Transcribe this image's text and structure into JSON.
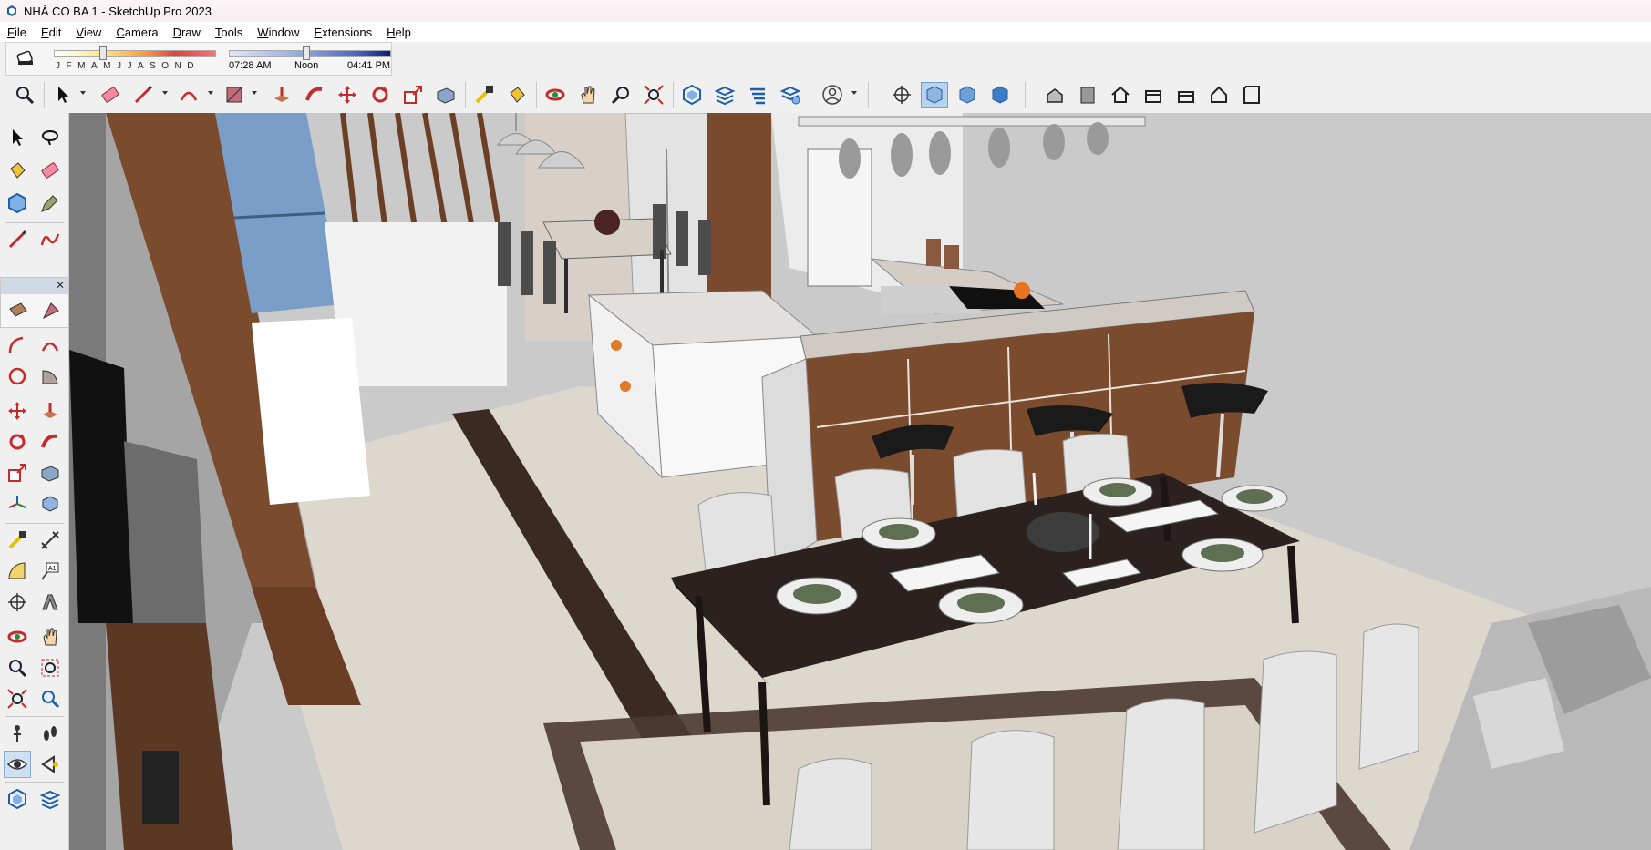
{
  "window": {
    "title": "NHÀ CO BA 1 - SketchUp Pro 2023"
  },
  "menu": [
    {
      "key": "F",
      "rest": "ile"
    },
    {
      "key": "E",
      "rest": "dit"
    },
    {
      "key": "V",
      "rest": "iew"
    },
    {
      "key": "C",
      "rest": "amera"
    },
    {
      "key": "D",
      "rest": "raw"
    },
    {
      "key": "T",
      "rest": "ools"
    },
    {
      "key": "W",
      "rest": "indow"
    },
    {
      "key": "E",
      "rest": "xtensions"
    },
    {
      "key": "H",
      "rest": "elp"
    }
  ],
  "shadows": {
    "months": "JFMAMJJASOND",
    "time_start": "07:28 AM",
    "time_noon": "Noon",
    "time_end": "04:41 PM",
    "month_position": 0.3,
    "time_position": 0.48
  },
  "colors": {
    "accent": "#b7d3ef",
    "wood": "#6b3f24",
    "counter": "#d9d6d2",
    "table": "#2b211e",
    "chair": "#e3e3e3"
  },
  "icons": {
    "toolbar": [
      "zoom-icon",
      "select-icon",
      "eraser-icon",
      "pencil-icon",
      "arc-icon",
      "shape-icon",
      "push-pull-icon",
      "follow-me-icon",
      "move-icon",
      "rotate-icon",
      "scale-icon",
      "offset-icon",
      "tape-measure-icon",
      "paint-bucket-icon",
      "orbit-icon",
      "pan-icon",
      "zoom-window-icon",
      "zoom-extents-icon",
      "components-icon",
      "layers-icon",
      "outliner-icon",
      "scenes-icon",
      "account-icon",
      "section-plane-icon",
      "xray-icon",
      "wireframe-icon",
      "shaded-icon",
      "iso-view-icon",
      "top-view-icon",
      "front-view-icon",
      "right-view-icon",
      "back-view-icon",
      "left-view-icon",
      "bottom-view-icon"
    ]
  }
}
